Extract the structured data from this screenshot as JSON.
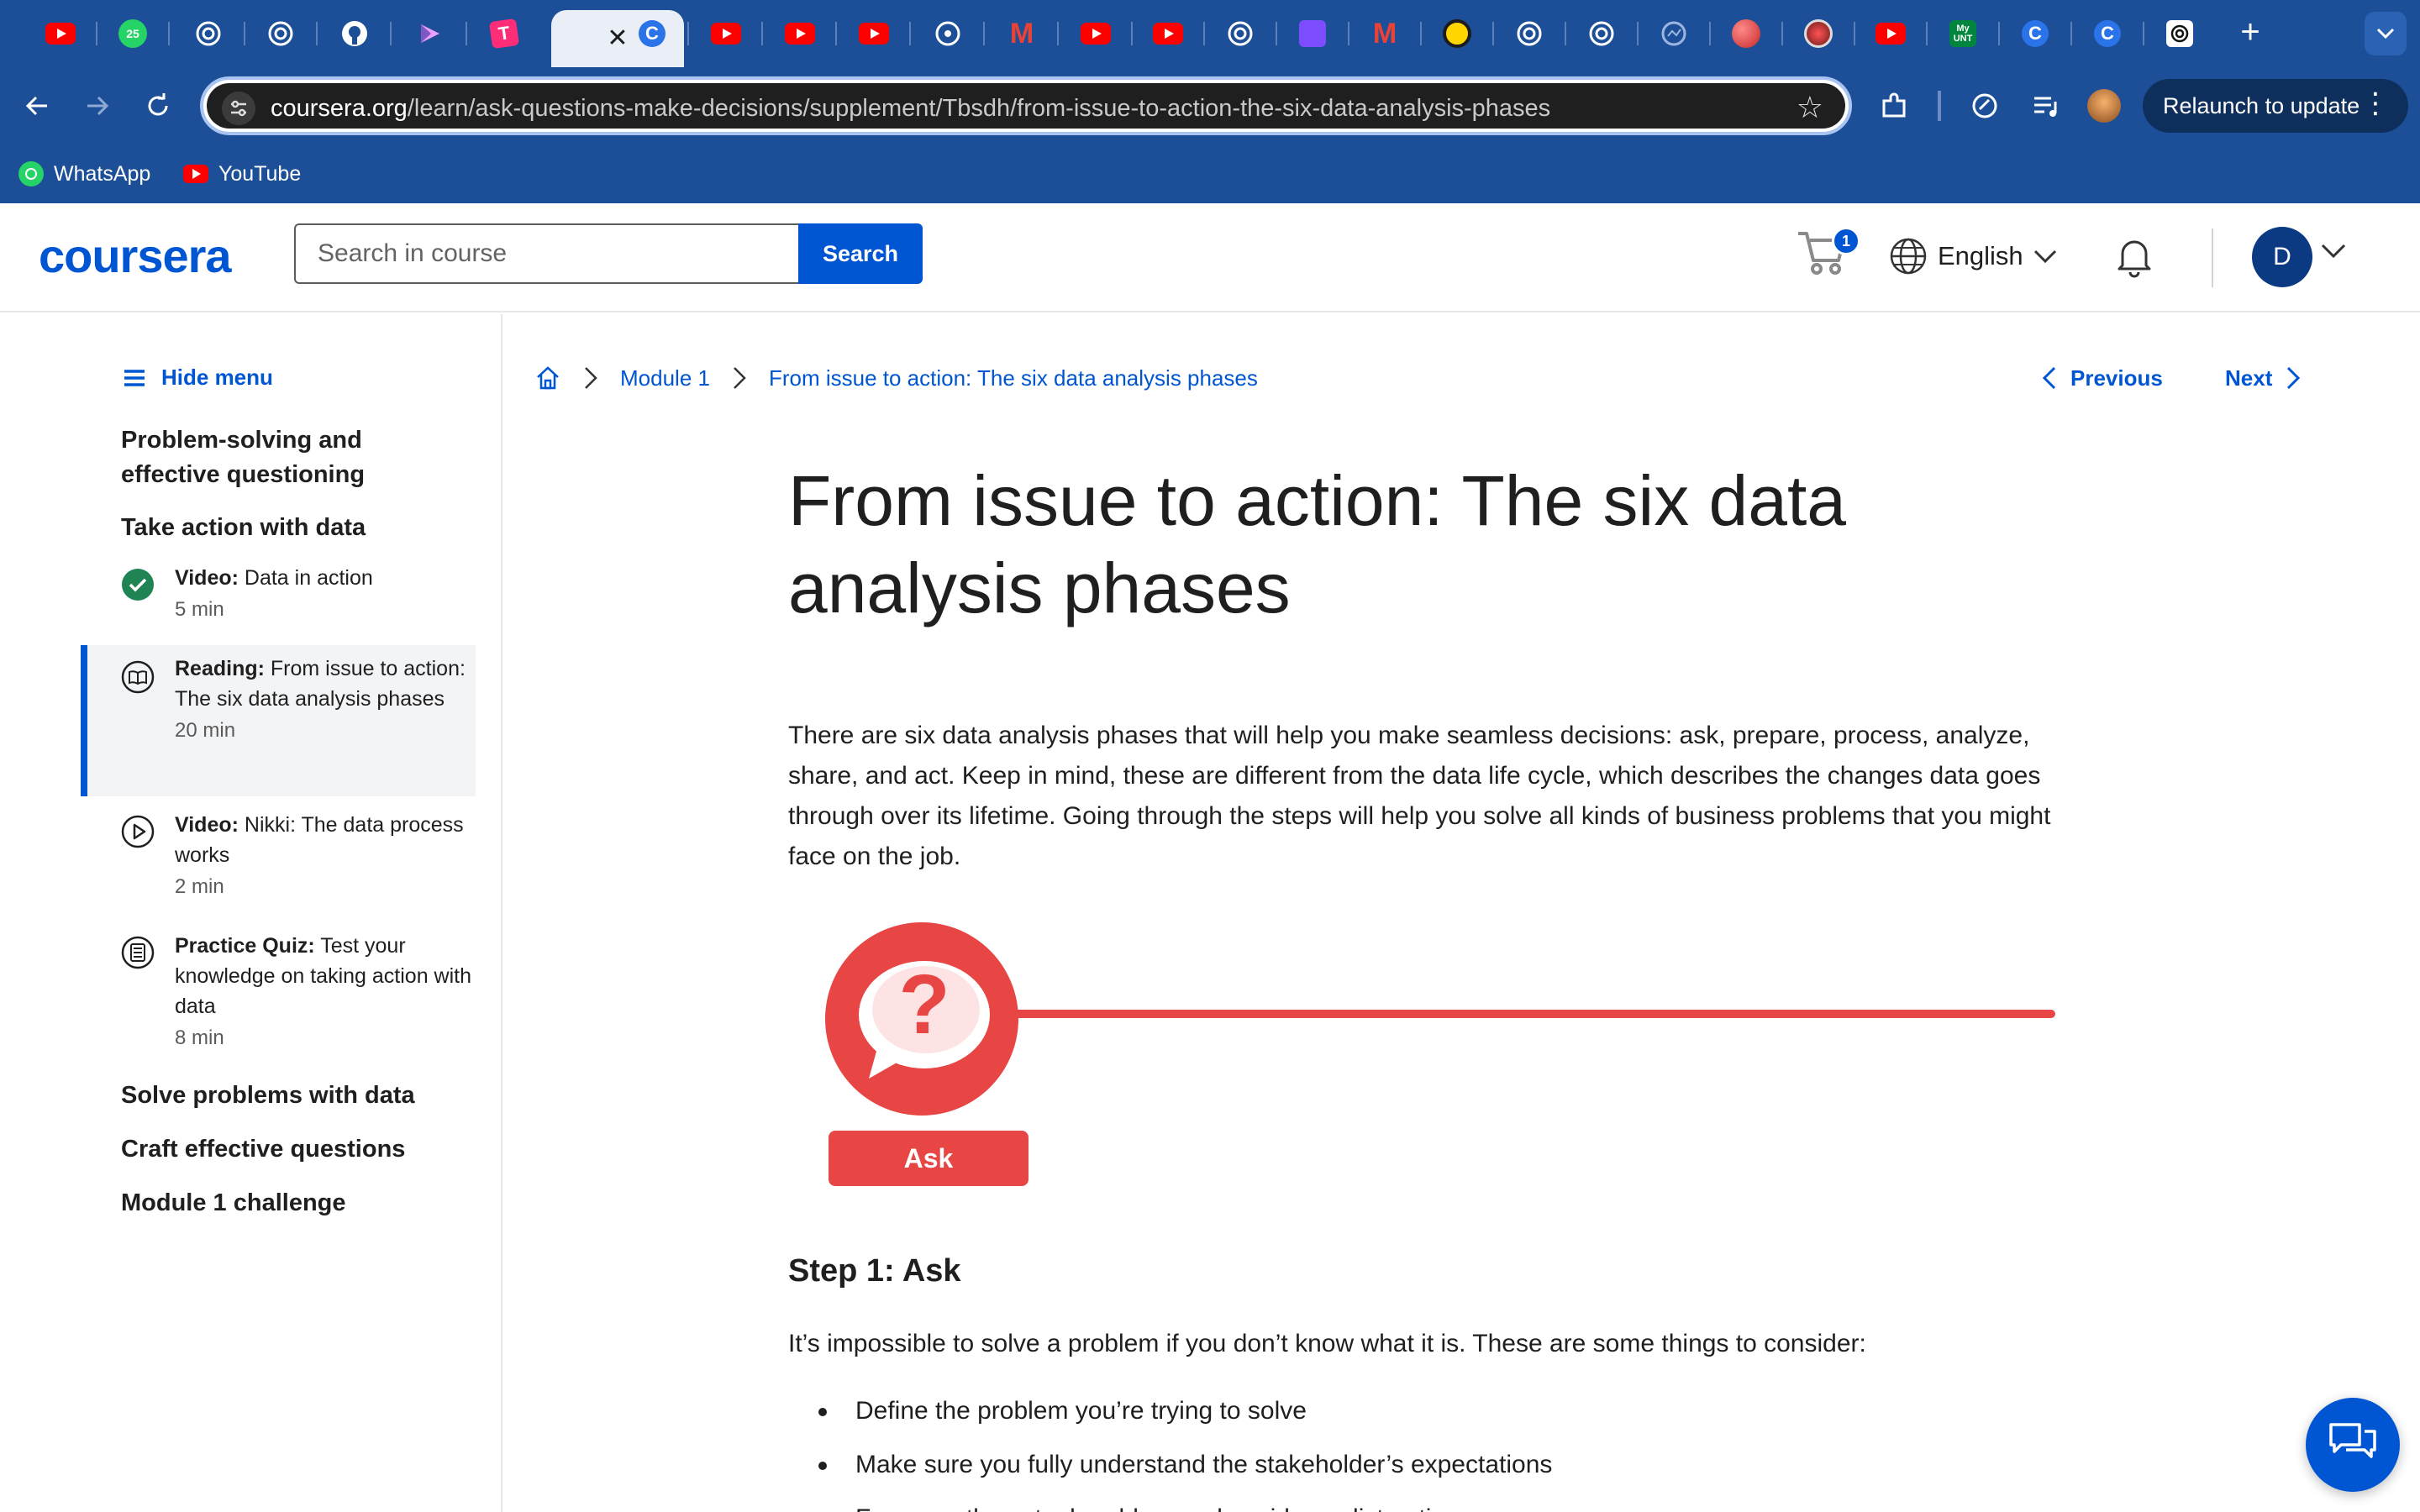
{
  "browser": {
    "url_host": "coursera.org",
    "url_path": "/learn/ask-questions-make-decisions/supplement/Tbsdh/from-issue-to-action-the-six-data-analysis-phases",
    "relaunch_label": "Relaunch to update",
    "tabs": [
      {
        "icon": "youtube-icon"
      },
      {
        "icon": "whatsapp-icon",
        "badge": "25"
      },
      {
        "icon": "openai-icon"
      },
      {
        "icon": "openai-icon"
      },
      {
        "icon": "github-icon"
      },
      {
        "icon": "app-icon"
      },
      {
        "icon": "app-icon"
      },
      {
        "icon": "close-icon",
        "active": true
      },
      {
        "icon": "coursera-icon",
        "text": "C"
      },
      {
        "icon": "youtube-icon"
      },
      {
        "icon": "youtube-icon"
      },
      {
        "icon": "youtube-icon"
      },
      {
        "icon": "app-icon"
      },
      {
        "icon": "gmail-icon",
        "text": "M"
      },
      {
        "icon": "youtube-icon"
      },
      {
        "icon": "youtube-icon"
      },
      {
        "icon": "openai-icon"
      },
      {
        "icon": "app-icon"
      },
      {
        "icon": "gmail-icon",
        "text": "M"
      },
      {
        "icon": "app-icon"
      },
      {
        "icon": "app-icon"
      },
      {
        "icon": "app-icon"
      },
      {
        "icon": "app-icon"
      },
      {
        "icon": "app-icon"
      },
      {
        "icon": "app-icon"
      },
      {
        "icon": "youtube-icon"
      },
      {
        "icon": "app-icon",
        "text": "My UNT"
      },
      {
        "icon": "coursera-icon",
        "text": "C"
      },
      {
        "icon": "coursera-icon",
        "text": "C"
      },
      {
        "icon": "openai-icon"
      }
    ],
    "bookmarks": [
      {
        "label": "WhatsApp",
        "icon": "whatsapp-icon"
      },
      {
        "label": "YouTube",
        "icon": "youtube-icon"
      }
    ]
  },
  "header": {
    "logo": "coursera",
    "search_placeholder": "Search in course",
    "search_button": "Search",
    "cart_count": "1",
    "language": "English",
    "avatar_initial": "D"
  },
  "sidebar": {
    "hide_menu": "Hide menu",
    "sections": [
      "Problem-solving and effective questioning",
      "Take action with data",
      "Solve problems with data",
      "Craft effective questions",
      "Module 1 challenge"
    ],
    "items": [
      {
        "type": "Video:",
        "title": "Data in action",
        "duration": "5 min",
        "status": "completed"
      },
      {
        "type": "Reading:",
        "title": "From issue to action: The six data analysis phases",
        "duration": "20 min",
        "status": "active"
      },
      {
        "type": "Video:",
        "title": "Nikki: The data process works",
        "duration": "2 min",
        "status": "not-started"
      },
      {
        "type": "Practice Quiz:",
        "title": "Test your knowledge on taking action with data",
        "duration": "8 min",
        "status": "not-started"
      }
    ]
  },
  "breadcrumb": {
    "module": "Module 1",
    "current": "From issue to action: The six data analysis phases"
  },
  "nav": {
    "previous": "Previous",
    "next": "Next"
  },
  "content": {
    "title": "From issue to action: The six data analysis phases",
    "intro": "There are six data analysis phases that will help you make seamless decisions: ask, prepare, process, analyze, share, and act. Keep in mind, these are different from the data life cycle, which describes the changes data goes through over its lifetime. Going through the steps will help you solve all kinds of business problems that you might face on the job.",
    "figure_glyph": "?",
    "figure_label": "Ask",
    "step_title": "Step 1: Ask",
    "step_text": "It’s impossible to solve a problem if you don’t know what it is. These are some things to consider:",
    "bullets": [
      "Define the problem you’re trying to solve",
      "Make sure you fully understand the stakeholder’s expectations",
      "Focus on the actual problem and avoid any distractions"
    ]
  },
  "colors": {
    "chrome": "#1c4f97",
    "brand": "#0056d2",
    "accent_red": "#e84545",
    "completed_green": "#1f8354"
  }
}
